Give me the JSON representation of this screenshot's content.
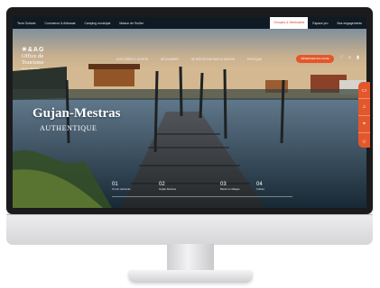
{
  "topbar": {
    "items": [
      "Terre Océane",
      "Commerce & Artisanat",
      "Camping municipal",
      "Maison de l'huître"
    ],
    "right": [
      "Groupes & Séminaires",
      "Espace pro",
      "Nos engagements"
    ]
  },
  "logo": {
    "mark": "✳&AG",
    "line1": "Office de",
    "line2": "Tourisme",
    "line3": "Gujan-Mestras"
  },
  "nav": [
    "EXPLORER ET SORTIR",
    "SÉJOURNER",
    "SE RÉFLÉCHIR SUR LE BASSIN",
    "PRATIQUE"
  ],
  "cta": "RÉSERVER EN LIGNE",
  "hero": {
    "title": "Gujan-Mestras",
    "subtitle": "AUTHENTIQUE"
  },
  "steps": [
    {
      "num": "01",
      "label": "Terroir ostréicole"
    },
    {
      "num": "02",
      "label": "Guijan-Mestras"
    },
    {
      "num": "03",
      "label": "Bassin et villages"
    },
    {
      "num": "04",
      "label": "Culture"
    }
  ],
  "colors": {
    "accent": "#e3572a",
    "topbar": "#0f1a24",
    "frame": "#1b1b1d"
  }
}
